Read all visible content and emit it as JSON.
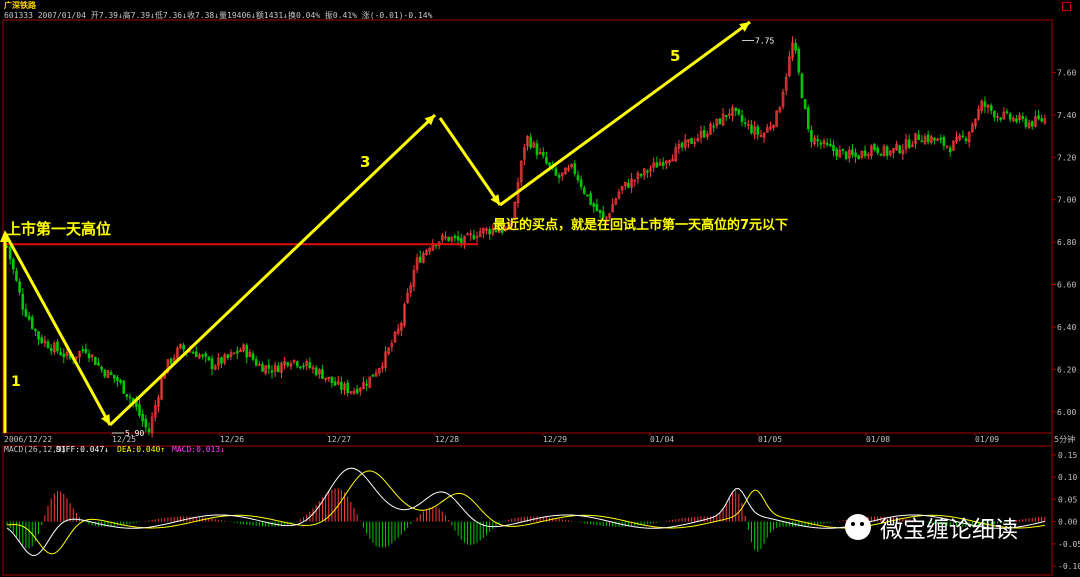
{
  "header": {
    "title": "广深铁路",
    "info": "601333 2007/01/04 开7.39↓高7.39↓低7.36↓收7.38↓量19406↓额1431↓换0.04% 振0.41% 涨(-0.01)-0.14%"
  },
  "colors": {
    "background": "#000000",
    "up": "#ff3b3b",
    "down": "#00c800",
    "frame": "#a00000",
    "axis_text": "#c0c0c0",
    "annotation": "#ffff00",
    "hline": "#e01010",
    "macd_diff": "#ffffff",
    "macd_dea": "#ffff00"
  },
  "chart_data": [
    {
      "type": "candlestick",
      "title": "广深铁路",
      "period": "5分钟",
      "ylim": [
        5.9,
        7.8
      ],
      "y_ticks": [
        "6.00",
        "6.20",
        "6.40",
        "6.60",
        "6.80",
        "7.00",
        "7.20",
        "7.40",
        "7.60"
      ],
      "x_labels": [
        "2006/12/22",
        "12/25",
        "12/26",
        "12/27",
        "12/28",
        "12/29",
        "01/04",
        "01/05",
        "01/08",
        "01/09"
      ],
      "price_path_close": [
        6.78,
        6.5,
        6.35,
        6.3,
        6.25,
        6.3,
        6.2,
        6.15,
        6.05,
        5.9,
        6.2,
        6.3,
        6.28,
        6.22,
        6.25,
        6.3,
        6.22,
        6.2,
        6.25,
        6.22,
        6.18,
        6.12,
        6.1,
        6.15,
        6.25,
        6.4,
        6.7,
        6.8,
        6.82,
        6.8,
        6.85,
        6.86,
        6.86,
        7.3,
        7.2,
        7.1,
        7.15,
        7.0,
        6.9,
        7.05,
        7.1,
        7.15,
        7.2,
        7.25,
        7.3,
        7.35,
        7.42,
        7.35,
        7.3,
        7.4,
        7.75,
        7.3,
        7.25,
        7.22,
        7.2,
        7.25,
        7.22,
        7.25,
        7.3,
        7.28,
        7.25,
        7.3,
        7.45,
        7.4,
        7.38,
        7.36,
        7.38
      ],
      "marks": [
        {
          "label": "7.75",
          "value": 7.75
        },
        {
          "label": "5.90",
          "value": 5.9
        }
      ],
      "horizontal_line": {
        "value": 6.79,
        "label": "上市第一天高位"
      },
      "annotations": [
        {
          "text": "1"
        },
        {
          "text": "3"
        },
        {
          "text": "5"
        },
        {
          "text": "最近的买点，就是在回试上市第一天高位的7元以下"
        }
      ]
    },
    {
      "type": "macd",
      "title": "MACD(26,12,9)",
      "legend": {
        "diff": "DIFF:0.047↓",
        "dea": "DEA:0.040↑",
        "macd": "MACD:0.013↓"
      },
      "ylim": [
        -0.12,
        0.17
      ],
      "y_ticks": [
        "0.15",
        "0.10",
        "0.05",
        "0.00",
        "-0.05",
        "-0.10"
      ]
    }
  ],
  "watermark": {
    "text": "微宝缠论细读"
  }
}
